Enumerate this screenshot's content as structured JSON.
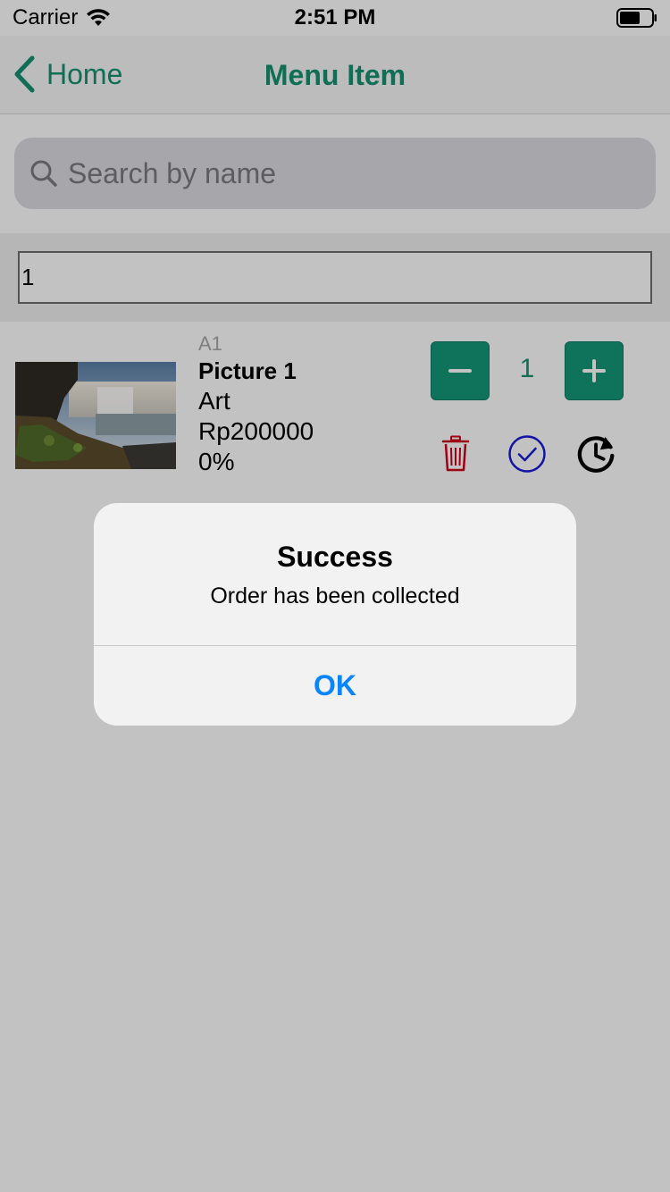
{
  "status_bar": {
    "carrier": "Carrier",
    "time": "2:51 PM",
    "wifi_icon": "wifi-icon",
    "battery_icon": "battery-icon"
  },
  "nav": {
    "back_label": "Home",
    "title": "Menu Item",
    "accent_color": "#14916f"
  },
  "search": {
    "placeholder": "Search by name",
    "value": ""
  },
  "filter": {
    "value": "1"
  },
  "item": {
    "code": "A1",
    "name": "Picture 1",
    "category": "Art",
    "price": "Rp200000",
    "discount": "0%",
    "quantity": "1",
    "thumbnail_icon": "waterfall-image",
    "actions": {
      "decrement_icon": "minus-icon",
      "increment_icon": "plus-icon",
      "delete_icon": "trash-icon",
      "confirm_icon": "check-circle-icon",
      "history_icon": "history-clock-icon"
    },
    "colors": {
      "button": "#15987a",
      "delete": "#d0021b",
      "confirm": "#1a1ad8"
    }
  },
  "alert": {
    "title": "Success",
    "message": "Order has been collected",
    "ok_label": "OK",
    "ok_color": "#0a84ff"
  }
}
